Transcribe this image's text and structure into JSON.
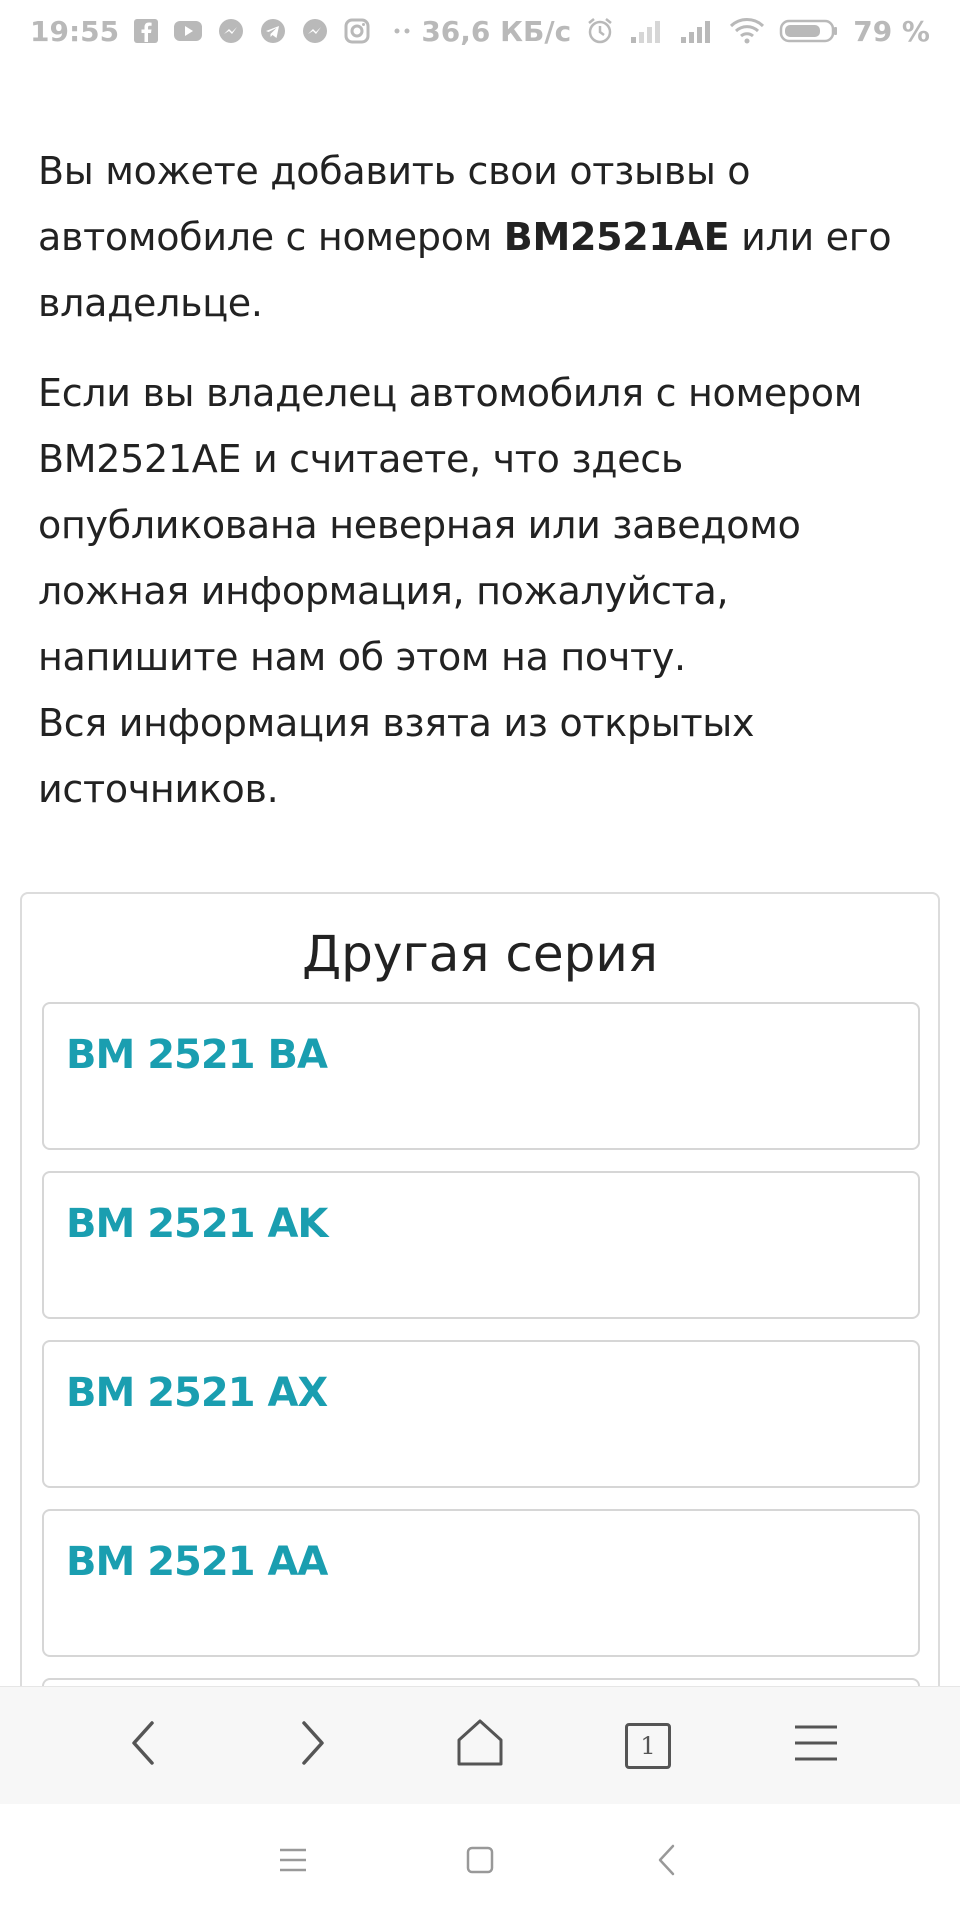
{
  "status_bar": {
    "time": "19:55",
    "network_speed": "36,6 КБ/с",
    "battery_percent": "79 %",
    "notification_icons": [
      "facebook-icon",
      "youtube-icon",
      "messenger-icon",
      "telegram-icon",
      "messenger-icon",
      "instagram-icon",
      "more-dots-icon"
    ],
    "system_icons": [
      "alarm-icon",
      "signal-icon",
      "signal-icon",
      "wifi-icon",
      "battery-icon"
    ],
    "battery_level": 0.79
  },
  "intro": {
    "line_before": "Вы можете добавить свои отзывы о автомобиле с номером ",
    "plate": "BM2521AE",
    "line_after": " или его владельце."
  },
  "notice": {
    "text": "Если вы владелец автомобиля с номером BM2521AE и считаете, что здесь опубликована неверная или заведомо ложная информация, пожалуйста, напишите нам об этом на почту.",
    "sources": "Вся информация взята из открытых источников."
  },
  "other_series": {
    "title": "Другая серия",
    "items": [
      {
        "label": "BM 2521 BA"
      },
      {
        "label": "BM 2521 AK"
      },
      {
        "label": "BM 2521 AX"
      },
      {
        "label": "BM 2521 AA"
      }
    ]
  },
  "browser_toolbar": {
    "buttons": [
      "back-icon",
      "forward-icon",
      "home-icon",
      "tabs-icon",
      "menu-icon"
    ],
    "tab_count": "1"
  },
  "system_nav": {
    "buttons": [
      "recents-icon",
      "home-square-icon",
      "back-triangle-icon"
    ]
  },
  "colors": {
    "link": "#1a9eb0",
    "text": "#222222",
    "status": "#b9b9b9"
  }
}
